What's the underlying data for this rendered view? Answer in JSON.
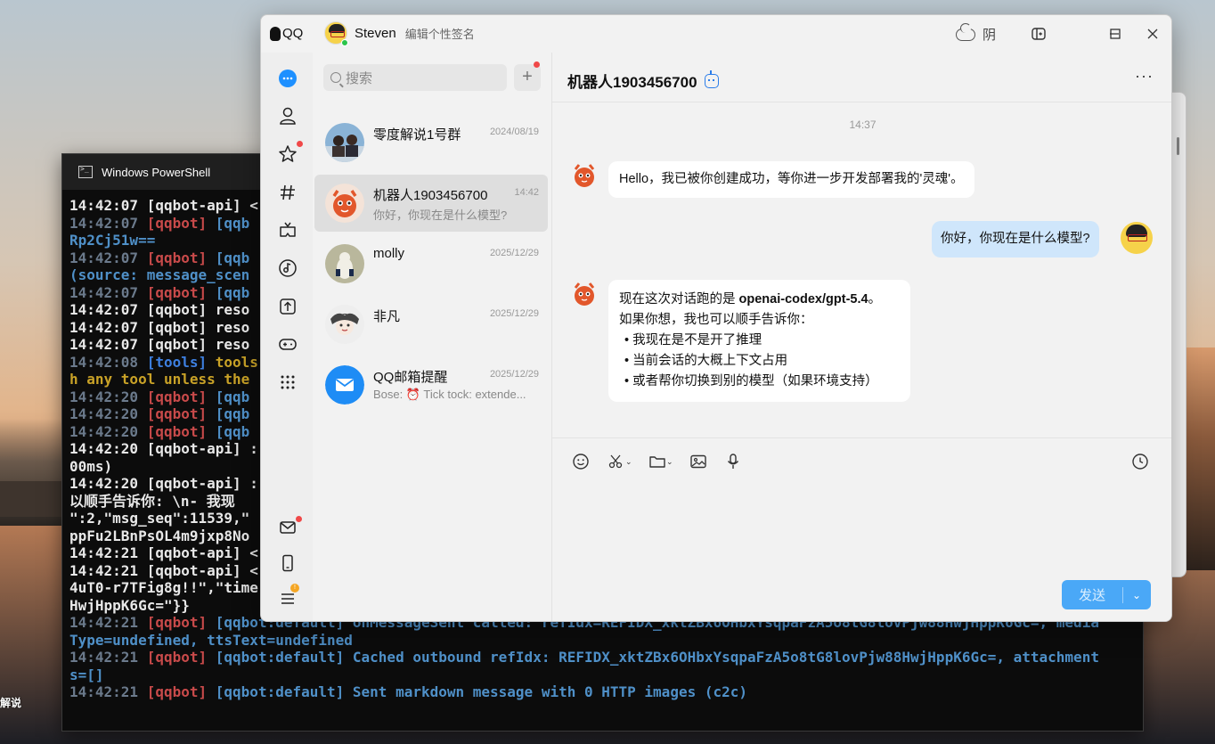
{
  "desktop": {
    "label": "解说"
  },
  "powershell": {
    "title": "Windows PowerShell",
    "lines": [
      [
        {
          "t": "14:42:07 [qqbot-api] <",
          "c": "c-white"
        }
      ],
      [
        {
          "t": "14:42:07 ",
          "c": "c-dim"
        },
        {
          "t": "[qqbot]",
          "c": "c-red"
        },
        {
          "t": " [qqb",
          "c": "c-cyan"
        }
      ],
      [
        {
          "t": "Rp2Cj51w==",
          "c": "c-cyan"
        }
      ],
      [
        {
          "t": "14:42:07 ",
          "c": "c-dim"
        },
        {
          "t": "[qqbot]",
          "c": "c-red"
        },
        {
          "t": " [qqb",
          "c": "c-cyan"
        }
      ],
      [
        {
          "t": "(source: message_scen",
          "c": "c-cyan"
        }
      ],
      [
        {
          "t": "14:42:07 ",
          "c": "c-dim"
        },
        {
          "t": "[qqbot]",
          "c": "c-red"
        },
        {
          "t": " [qqb",
          "c": "c-cyan"
        }
      ],
      [
        {
          "t": "14:42:07 [qqbot] reso",
          "c": "c-white"
        }
      ],
      [
        {
          "t": "14:42:07 [qqbot] reso",
          "c": "c-white"
        }
      ],
      [
        {
          "t": "14:42:07 [qqbot] reso",
          "c": "c-white"
        }
      ],
      [
        {
          "t": "14:42:08 ",
          "c": "c-dim"
        },
        {
          "t": "[tools]",
          "c": "c-blue"
        },
        {
          "t": " tools",
          "c": "c-yellow"
        }
      ],
      [
        {
          "t": "h any tool unless the",
          "c": "c-yellow"
        }
      ],
      [
        {
          "t": "14:42:20 ",
          "c": "c-dim"
        },
        {
          "t": "[qqbot]",
          "c": "c-red"
        },
        {
          "t": " [qqb",
          "c": "c-cyan"
        }
      ],
      [
        {
          "t": "14:42:20 ",
          "c": "c-dim"
        },
        {
          "t": "[qqbot]",
          "c": "c-red"
        },
        {
          "t": " [qqb",
          "c": "c-cyan"
        }
      ],
      [
        {
          "t": "14:42:20 ",
          "c": "c-dim"
        },
        {
          "t": "[qqbot]",
          "c": "c-red"
        },
        {
          "t": " [qqb",
          "c": "c-cyan"
        }
      ],
      [
        {
          "t": "14:42:20 [qqbot-api] :",
          "c": "c-white"
        }
      ],
      [
        {
          "t": "00ms)",
          "c": "c-white"
        }
      ],
      [
        {
          "t": "14:42:20 [qqbot-api] :",
          "c": "c-white"
        }
      ],
      [
        {
          "t": "以顺手告诉你: \\n- 我现",
          "c": "c-white"
        }
      ],
      [
        {
          "t": "\":2,\"msg_seq\":11539,\"",
          "c": "c-white"
        }
      ],
      [
        {
          "t": "ppFu2LBnPsOL4m9jxp8No",
          "c": "c-white"
        }
      ],
      [
        {
          "t": "14:42:21 [qqbot-api] <",
          "c": "c-white"
        }
      ],
      [
        {
          "t": "14:42:21 [qqbot-api] <",
          "c": "c-white"
        }
      ],
      [
        {
          "t": "4uT0-r7TFig8g!!\",\"time",
          "c": "c-white"
        }
      ],
      [
        {
          "t": "HwjHppK6Gc=\"}}",
          "c": "c-white"
        }
      ],
      [
        {
          "t": "14:42:21 ",
          "c": "c-dim"
        },
        {
          "t": "[qqbot]",
          "c": "c-red"
        },
        {
          "t": " [qqbot:default] onMessageSent called: refIdx=REFIDX_xktZBx6OHbxYsqpaFzA5o8tG8lovPjw88HwjHppK6Gc=, media",
          "c": "c-cyan"
        }
      ],
      [
        {
          "t": "Type=undefined, ttsText=undefined",
          "c": "c-cyan"
        }
      ],
      [
        {
          "t": "14:42:21 ",
          "c": "c-dim"
        },
        {
          "t": "[qqbot]",
          "c": "c-red"
        },
        {
          "t": " [qqbot:default] Cached outbound refIdx: REFIDX_xktZBx6OHbxYsqpaFzA5o8tG8lovPjw88HwjHppK6Gc=, attachment",
          "c": "c-cyan"
        }
      ],
      [
        {
          "t": "s=[]",
          "c": "c-cyan"
        }
      ],
      [
        {
          "t": "14:42:21 ",
          "c": "c-dim"
        },
        {
          "t": "[qqbot]",
          "c": "c-red"
        },
        {
          "t": " [qqbot:default] Sent markdown message with 0 HTTP images (c2c)",
          "c": "c-cyan"
        }
      ]
    ]
  },
  "qq": {
    "logo": "QQ",
    "user": {
      "name": "Steven",
      "signature": "编辑个性签名"
    },
    "weather": "阴",
    "search": {
      "placeholder": "搜索"
    },
    "sessions": [
      {
        "name": "零度解说1号群",
        "time": "2024/08/19",
        "preview": "",
        "avatar": "group"
      },
      {
        "name": "机器人1903456700",
        "time": "14:42",
        "preview": "你好，你现在是什么模型?",
        "avatar": "bot",
        "active": true
      },
      {
        "name": "molly",
        "time": "2025/12/29",
        "preview": "",
        "avatar": "molly"
      },
      {
        "name": "非凡",
        "time": "2025/12/29",
        "preview": "",
        "avatar": "feifan"
      },
      {
        "name": "QQ邮箱提醒",
        "time": "2025/12/29",
        "preview": "Bose: ⏰ Tick tock: extende...",
        "avatar": "mail"
      }
    ],
    "chat": {
      "title": "机器人1903456700",
      "time_separator": "14:37",
      "msg1": "Hello，我已被你创建成功，等你进一步开发部署我的'灵魂'。",
      "msg2": "你好，你现在是什么模型?",
      "msg3": {
        "line1_pre": "现在这次对话跑的是 ",
        "line1_bold": "openai-codex/gpt-5.4",
        "line1_post": "。",
        "line2": "如果你想，我也可以顺手告诉你：",
        "bullets": [
          "我现在是不是开了推理",
          "当前会话的大概上下文占用",
          "或者帮你切换到别的模型（如果环境支持）"
        ]
      },
      "send_label": "发送"
    }
  }
}
